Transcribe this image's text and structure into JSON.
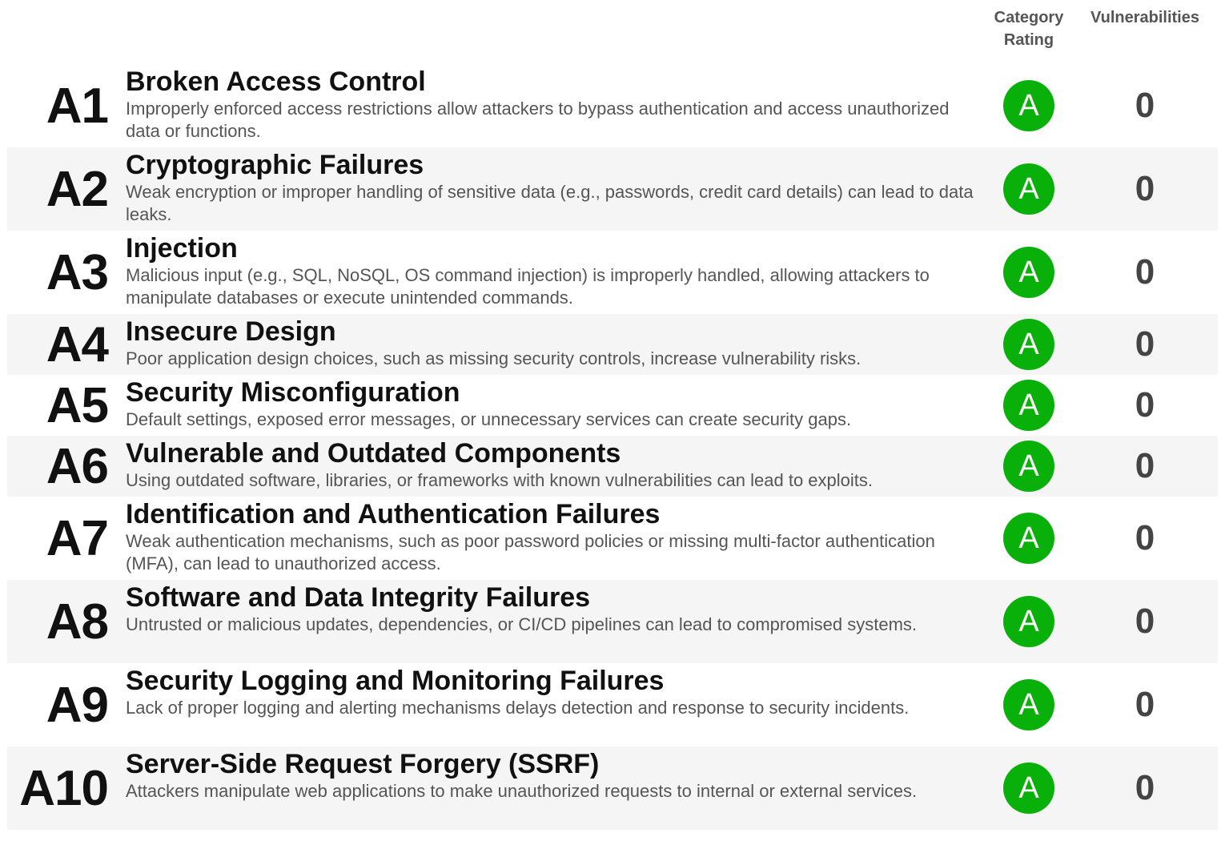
{
  "header": {
    "rating_label": "Category Rating",
    "vulnerabilities_label": "Vulnerabilities"
  },
  "colors": {
    "badge_green": "#0ab00a",
    "row_alt_bg": "#f5f5f5"
  },
  "rows": [
    {
      "code": "A1",
      "title": "Broken Access Control",
      "description": "Improperly enforced access restrictions allow attackers to bypass authentication and access unauthorized data or functions.",
      "rating": "A",
      "vulnerabilities": "0"
    },
    {
      "code": "A2",
      "title": "Cryptographic Failures",
      "description": "Weak encryption or improper handling of sensitive data (e.g., passwords, credit card details) can lead to data leaks.",
      "rating": "A",
      "vulnerabilities": "0"
    },
    {
      "code": "A3",
      "title": "Injection",
      "description": "Malicious input (e.g., SQL, NoSQL, OS command injection) is improperly handled, allowing attackers to manipulate databases or execute unintended commands.",
      "rating": "A",
      "vulnerabilities": "0"
    },
    {
      "code": "A4",
      "title": "Insecure Design",
      "description": "Poor application design choices, such as missing security controls, increase vulnerability risks.",
      "rating": "A",
      "vulnerabilities": "0"
    },
    {
      "code": "A5",
      "title": "Security Misconfiguration",
      "description": "Default settings, exposed error messages, or unnecessary services can create security gaps.",
      "rating": "A",
      "vulnerabilities": "0"
    },
    {
      "code": "A6",
      "title": "Vulnerable and Outdated Components",
      "description": "Using outdated software, libraries, or frameworks with known vulnerabilities can lead to exploits.",
      "rating": "A",
      "vulnerabilities": "0"
    },
    {
      "code": "A7",
      "title": "Identification and Authentication Failures",
      "description": "Weak authentication mechanisms, such as poor password policies or missing multi-factor authentication (MFA), can lead to unauthorized access.",
      "rating": "A",
      "vulnerabilities": "0"
    },
    {
      "code": "A8",
      "title": "Software and Data Integrity Failures",
      "description": "Untrusted or malicious updates, dependencies, or CI/CD pipelines can lead to compromised systems.",
      "rating": "A",
      "vulnerabilities": "0"
    },
    {
      "code": "A9",
      "title": "Security Logging and Monitoring Failures",
      "description": "Lack of proper logging and alerting mechanisms delays detection and response to security incidents.",
      "rating": "A",
      "vulnerabilities": "0"
    },
    {
      "code": "A10",
      "title": "Server-Side Request Forgery (SSRF)",
      "description": "Attackers manipulate web applications to make unauthorized requests to internal or external services.",
      "rating": "A",
      "vulnerabilities": "0"
    }
  ]
}
